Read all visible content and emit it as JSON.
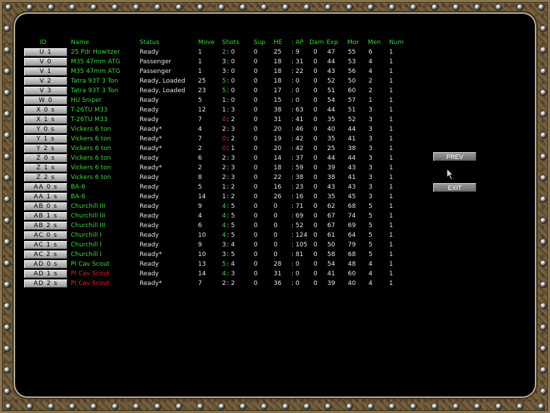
{
  "headers": {
    "id": "ID",
    "name": "Name",
    "status": "Status",
    "move": "Move",
    "shots": "Shots",
    "sup": "Sup",
    "he": "HE",
    "ap": ": AP",
    "dam": "Dam",
    "exp": "Exp",
    "mor": "Mor",
    "men": "Men",
    "num": "Num"
  },
  "rows": [
    {
      "id": "U 1",
      "name": "25 Pdr Howitzer",
      "status": "Ready",
      "move": "1",
      "shots_a": "2",
      "shots_b": ": 0",
      "sup": "0",
      "he": "25",
      "ap": ": 9",
      "dam": "0",
      "exp": "47",
      "mor": "55",
      "men": "6",
      "num": "1",
      "name_color": "green",
      "shots_color": "green"
    },
    {
      "id": "V 0",
      "name": "M35 47mm ATG",
      "status": "Passenger",
      "move": "1",
      "shots_a": "3",
      "shots_b": ": 0",
      "sup": "0",
      "he": "18",
      "ap": ": 31",
      "dam": "0",
      "exp": "44",
      "mor": "53",
      "men": "4",
      "num": "1",
      "name_color": "green",
      "shots_color": "white"
    },
    {
      "id": "V 1",
      "name": "M35 47mm ATG",
      "status": "Passenger",
      "move": "1",
      "shots_a": "3",
      "shots_b": ": 0",
      "sup": "0",
      "he": "18",
      "ap": ": 22",
      "dam": "0",
      "exp": "43",
      "mor": "56",
      "men": "4",
      "num": "1",
      "name_color": "green",
      "shots_color": "white"
    },
    {
      "id": "V 2",
      "name": "Tatra 93T 3 Ton",
      "status": "Ready,   Loaded",
      "move": "25",
      "shots_a": "5",
      "shots_b": ": 0",
      "sup": "0",
      "he": "18",
      "ap": ": 0",
      "dam": "0",
      "exp": "52",
      "mor": "50",
      "men": "2",
      "num": "1",
      "name_color": "green",
      "shots_color": "green"
    },
    {
      "id": "V 3",
      "name": "Tatra 93T 3 Ton",
      "status": "Ready,   Loaded",
      "move": "23",
      "shots_a": "5",
      "shots_b": ": 0",
      "sup": "0",
      "he": "17",
      "ap": ": 0",
      "dam": "0",
      "exp": "51",
      "mor": "60",
      "men": "2",
      "num": "1",
      "name_color": "green",
      "shots_color": "green"
    },
    {
      "id": "W 0",
      "name": "HU Sniper",
      "status": "Ready",
      "move": "5",
      "shots_a": "1",
      "shots_b": ": 0",
      "sup": "0",
      "he": "15",
      "ap": ": 0",
      "dam": "0",
      "exp": "54",
      "mor": "57",
      "men": "1",
      "num": "1",
      "name_color": "green",
      "shots_color": "white"
    },
    {
      "id": "X 0 s",
      "name": "T-26TU M33",
      "status": "Ready",
      "move": "12",
      "shots_a": "1",
      "shots_b": ": 3",
      "sup": "0",
      "he": "38",
      "ap": ": 63",
      "dam": "0",
      "exp": "44",
      "mor": "51",
      "men": "3",
      "num": "1",
      "name_color": "green",
      "shots_color": "white"
    },
    {
      "id": "X 1 s",
      "name": "T-26TU M33",
      "status": "Ready",
      "move": "7",
      "shots_a": "0",
      "shots_b": ": 2",
      "sup": "0",
      "he": "31",
      "ap": ": 41",
      "dam": "0",
      "exp": "35",
      "mor": "52",
      "men": "3",
      "num": "1",
      "name_color": "green",
      "shots_color": "red"
    },
    {
      "id": "Y 0 s",
      "name": "Vickers 6 ton",
      "status": "Ready*",
      "move": "4",
      "shots_a": "2",
      "shots_b": ": 3",
      "sup": "0",
      "he": "20",
      "ap": ": 46",
      "dam": "0",
      "exp": "40",
      "mor": "44",
      "men": "3",
      "num": "1",
      "name_color": "green",
      "shots_color": "white"
    },
    {
      "id": "Y 1 s",
      "name": "Vickers 6 ton",
      "status": "Ready*",
      "move": "7",
      "shots_a": "0",
      "shots_b": ": 2",
      "sup": "0",
      "he": "19",
      "ap": ": 42",
      "dam": "0",
      "exp": "35",
      "mor": "41",
      "men": "3",
      "num": "1",
      "name_color": "green",
      "shots_color": "red"
    },
    {
      "id": "Y 2 s",
      "name": "Vickers 6 ton",
      "status": "Ready*",
      "move": "2",
      "shots_a": "0",
      "shots_b": ": 1",
      "sup": "0",
      "he": "20",
      "ap": ": 42",
      "dam": "0",
      "exp": "25",
      "mor": "38",
      "men": "3",
      "num": "1",
      "name_color": "green",
      "shots_color": "red"
    },
    {
      "id": "Z 0 s",
      "name": "Vickers 6 ton",
      "status": "Ready",
      "move": "6",
      "shots_a": "2",
      "shots_b": ": 3",
      "sup": "0",
      "he": "14",
      "ap": ": 37",
      "dam": "0",
      "exp": "44",
      "mor": "44",
      "men": "3",
      "num": "1",
      "name_color": "green",
      "shots_color": "white"
    },
    {
      "id": "Z 1 s",
      "name": "Vickers 6 ton",
      "status": "Ready*",
      "move": "2",
      "shots_a": "2",
      "shots_b": ": 3",
      "sup": "0",
      "he": "18",
      "ap": ": 59",
      "dam": "0",
      "exp": "39",
      "mor": "43",
      "men": "3",
      "num": "1",
      "name_color": "green",
      "shots_color": "white"
    },
    {
      "id": "Z 2 s",
      "name": "Vickers 6 ton",
      "status": "Ready",
      "move": "8",
      "shots_a": "2",
      "shots_b": ": 3",
      "sup": "0",
      "he": "22",
      "ap": ": 38",
      "dam": "0",
      "exp": "38",
      "mor": "41",
      "men": "3",
      "num": "1",
      "name_color": "green",
      "shots_color": "white"
    },
    {
      "id": "AA 0 s",
      "name": "BA-6",
      "status": "Ready",
      "move": "5",
      "shots_a": "1",
      "shots_b": ": 2",
      "sup": "0",
      "he": "16",
      "ap": ": 23",
      "dam": "0",
      "exp": "43",
      "mor": "43",
      "men": "3",
      "num": "1",
      "name_color": "green",
      "shots_color": "white"
    },
    {
      "id": "AA 1 s",
      "name": "BA-6",
      "status": "Ready",
      "move": "14",
      "shots_a": "1",
      "shots_b": ": 2",
      "sup": "0",
      "he": "26",
      "ap": ": 16",
      "dam": "0",
      "exp": "35",
      "mor": "45",
      "men": "3",
      "num": "1",
      "name_color": "green",
      "shots_color": "white"
    },
    {
      "id": "AB 0 s",
      "name": "Churchill III",
      "status": "Ready",
      "move": "9",
      "shots_a": "4",
      "shots_b": ": 5",
      "sup": "0",
      "he": "0",
      "ap": ": 71",
      "dam": "0",
      "exp": "62",
      "mor": "68",
      "men": "5",
      "num": "1",
      "name_color": "green",
      "shots_color": "green"
    },
    {
      "id": "AB 1 s",
      "name": "Churchill III",
      "status": "Ready",
      "move": "4",
      "shots_a": "4",
      "shots_b": ": 5",
      "sup": "0",
      "he": "0",
      "ap": ": 69",
      "dam": "0",
      "exp": "67",
      "mor": "74",
      "men": "5",
      "num": "1",
      "name_color": "green",
      "shots_color": "green"
    },
    {
      "id": "AB 2 s",
      "name": "Churchill III",
      "status": "Ready",
      "move": "6",
      "shots_a": "4",
      "shots_b": ": 5",
      "sup": "0",
      "he": "0",
      "ap": ": 52",
      "dam": "0",
      "exp": "67",
      "mor": "69",
      "men": "5",
      "num": "1",
      "name_color": "green",
      "shots_color": "green"
    },
    {
      "id": "AC 0 s",
      "name": "Churchill I",
      "status": "Ready",
      "move": "10",
      "shots_a": "4",
      "shots_b": ": 5",
      "sup": "0",
      "he": "0",
      "ap": ": 124",
      "dam": "0",
      "exp": "61",
      "mor": "64",
      "men": "5",
      "num": "1",
      "name_color": "green",
      "shots_color": "green"
    },
    {
      "id": "AC 1 s",
      "name": "Churchill I",
      "status": "Ready",
      "move": "9",
      "shots_a": "3",
      "shots_b": ": 4",
      "sup": "0",
      "he": "0",
      "ap": ": 105",
      "dam": "0",
      "exp": "50",
      "mor": "79",
      "men": "5",
      "num": "1",
      "name_color": "green",
      "shots_color": "white"
    },
    {
      "id": "AC 2 s",
      "name": "Churchill I",
      "status": "Ready*",
      "move": "10",
      "shots_a": "3",
      "shots_b": ": 5",
      "sup": "0",
      "he": "0",
      "ap": ": 81",
      "dam": "0",
      "exp": "58",
      "mor": "68",
      "men": "5",
      "num": "1",
      "name_color": "green",
      "shots_color": "white"
    },
    {
      "id": "AD 0 s",
      "name": "PI Cav Scout",
      "status": "Ready",
      "move": "13",
      "shots_a": "5",
      "shots_b": ": 4",
      "sup": "0",
      "he": "28",
      "ap": ": 0",
      "dam": "0",
      "exp": "54",
      "mor": "48",
      "men": "4",
      "num": "1",
      "name_color": "green",
      "shots_color": "green"
    },
    {
      "id": "AD 1 s",
      "name": "PI Cav Scout",
      "status": "Ready",
      "move": "14",
      "shots_a": "4",
      "shots_b": ": 3",
      "sup": "0",
      "he": "31",
      "ap": ": 0",
      "dam": "0",
      "exp": "41",
      "mor": "60",
      "men": "4",
      "num": "1",
      "name_color": "red",
      "shots_color": "green"
    },
    {
      "id": "AD 2 s",
      "name": "PI Cav Scout",
      "status": "Ready*",
      "move": "7",
      "shots_a": "2",
      "shots_b": ": 2",
      "sup": "0",
      "he": "36",
      "ap": ": 0",
      "dam": "0",
      "exp": "39",
      "mor": "40",
      "men": "4",
      "num": "1",
      "name_color": "red",
      "shots_color": "white"
    }
  ],
  "buttons": {
    "prev": "PREV",
    "exit": "EXIT"
  },
  "colors": {
    "header": "#39d439",
    "green": "#3cd83c",
    "red": "#e02424",
    "white": "#e6e6e6",
    "panel": "#000000"
  }
}
